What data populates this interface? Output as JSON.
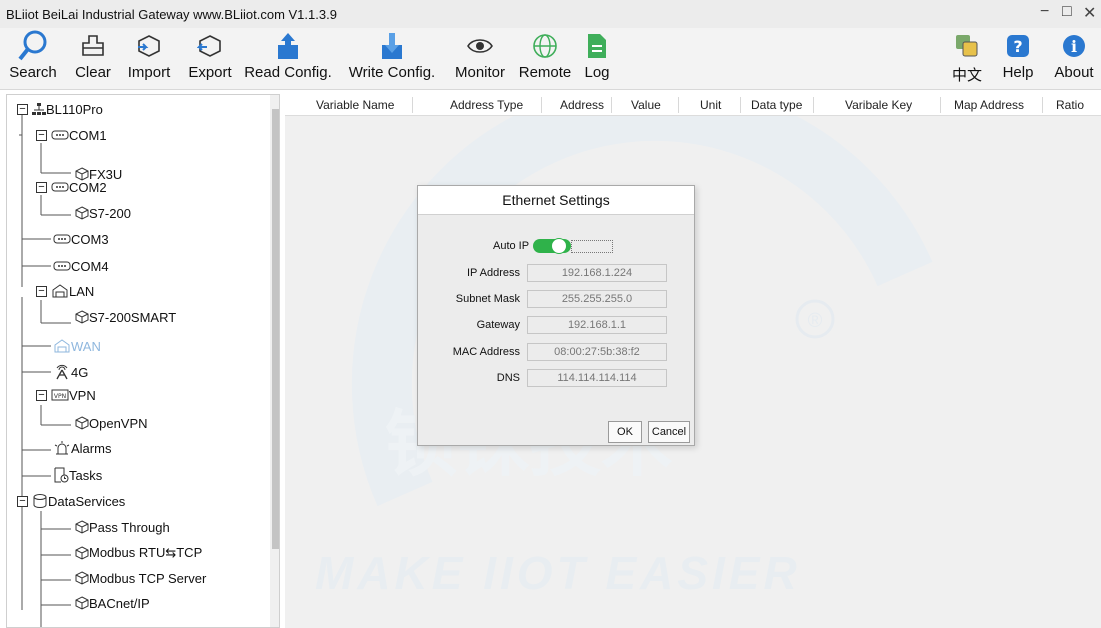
{
  "window": {
    "title": "BLiiot BeiLai Industrial Gateway www.BLiiot.com V1.1.3.9",
    "minimize_glyph": "−",
    "maximize_glyph": "□",
    "close_glyph": "✕"
  },
  "toolbar": {
    "search": "Search",
    "clear": "Clear",
    "import": "Import",
    "export": "Export",
    "read_config": "Read Config.",
    "write_config": "Write Config.",
    "monitor": "Monitor",
    "remote": "Remote",
    "log": "Log",
    "language": "中文",
    "help": "Help",
    "about": "About"
  },
  "tree": {
    "root": "BL110Pro",
    "com1": "COM1",
    "fx3u": "FX3U",
    "com2": "COM2",
    "s7200": "S7-200",
    "com3": "COM3",
    "com4": "COM4",
    "lan": "LAN",
    "s7200smart": "S7-200SMART",
    "wan": "WAN",
    "g4": "4G",
    "vpn": "VPN",
    "openvpn": "OpenVPN",
    "alarms": "Alarms",
    "tasks": "Tasks",
    "dataservices": "DataServices",
    "passthrough": "Pass Through",
    "modbus_rtu_tcp": "Modbus RTU⇆TCP",
    "modbus_tcp_server": "Modbus TCP Server",
    "bacnet": "BACnet/IP"
  },
  "grid": {
    "columns": [
      "Variable Name",
      "Address Type",
      "Address",
      "Value",
      "Unit",
      "Data type",
      "Varibale Key",
      "Map Address",
      "Ratio"
    ]
  },
  "watermark": {
    "slogan": "MAKE IIOT EASIER",
    "registered": "®",
    "chinese": "钡铼技术"
  },
  "dialog": {
    "title": "Ethernet Settings",
    "auto_ip_label": "Auto IP",
    "auto_ip_on": true,
    "ip_label": "IP Address",
    "ip_value": "192.168.1.224",
    "mask_label": "Subnet Mask",
    "mask_value": "255.255.255.0",
    "gateway_label": "Gateway",
    "gateway_value": "192.168.1.1",
    "mac_label": "MAC Address",
    "mac_value": "08:00:27:5b:38:f2",
    "dns_label": "DNS",
    "dns_value": "114.114.114.114",
    "ok": "OK",
    "cancel": "Cancel"
  },
  "colors": {
    "toggle": "#2fb24a",
    "icon_blue": "#2a78d0",
    "icon_green": "#3fae5a",
    "watermark": "#e9eef2"
  }
}
